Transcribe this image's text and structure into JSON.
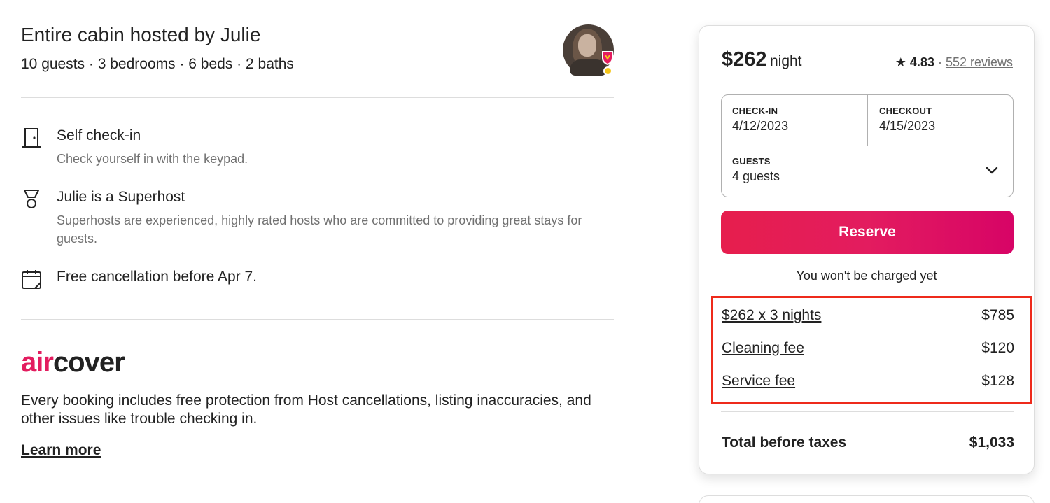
{
  "host": {
    "title": "Entire cabin hosted by Julie",
    "subtitle": "10 guests · 3 bedrooms · 6 beds · 2 baths"
  },
  "features": [
    {
      "icon": "door-icon",
      "title": "Self check-in",
      "desc": "Check yourself in with the keypad."
    },
    {
      "icon": "superhost-medal-icon",
      "title": "Julie is a Superhost",
      "desc": "Superhosts are experienced, highly rated hosts who are committed to providing great stays for guests."
    },
    {
      "icon": "calendar-icon",
      "title": "Free cancellation before Apr 7.",
      "desc": ""
    }
  ],
  "aircover": {
    "logo_air": "air",
    "logo_cover": "cover",
    "desc": "Every booking includes free protection from Host cancellations, listing inaccuracies, and other issues like trouble checking in.",
    "learn_more": "Learn more"
  },
  "booking": {
    "price": "$262",
    "per": "night",
    "rating": "4.83",
    "rating_sep": "·",
    "reviews": "552 reviews",
    "checkin_label": "CHECK-IN",
    "checkin_value": "4/12/2023",
    "checkout_label": "CHECKOUT",
    "checkout_value": "4/15/2023",
    "guests_label": "GUESTS",
    "guests_value": "4 guests",
    "reserve": "Reserve",
    "note": "You won't be charged yet",
    "fees": [
      {
        "label": "$262 x 3 nights",
        "value": "$785"
      },
      {
        "label": "Cleaning fee",
        "value": "$120"
      },
      {
        "label": "Service fee",
        "value": "$128"
      }
    ],
    "total_label": "Total before taxes",
    "total_value": "$1,033"
  },
  "colors": {
    "brand": "#e31c5f",
    "highlight": "#ee2a1b",
    "superhost_badge": "#f5c518"
  }
}
